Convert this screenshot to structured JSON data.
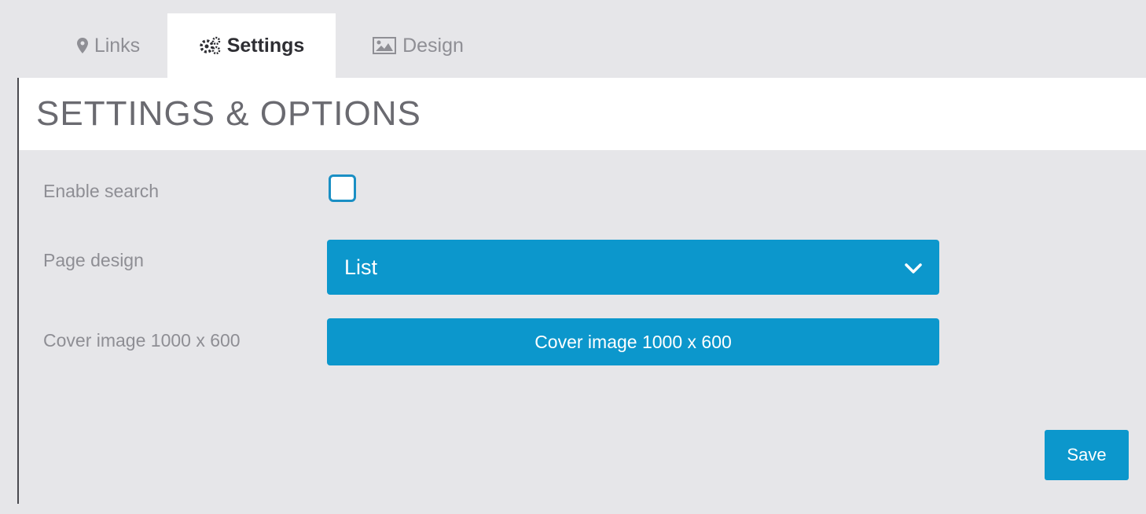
{
  "tabs": [
    {
      "label": "Links",
      "icon": "map-marker-icon",
      "active": false
    },
    {
      "label": "Settings",
      "icon": "cogs-icon",
      "active": true
    },
    {
      "label": "Design",
      "icon": "image-icon",
      "active": false
    }
  ],
  "section": {
    "title": "SETTINGS & OPTIONS"
  },
  "form": {
    "enable_search": {
      "label": "Enable search",
      "checked": false
    },
    "page_design": {
      "label": "Page design",
      "value": "List",
      "icon": "chevron-down-icon"
    },
    "cover_image": {
      "label": "Cover image 1000 x 600",
      "button_label": "Cover image 1000 x 600"
    }
  },
  "actions": {
    "save_label": "Save"
  },
  "colors": {
    "accent": "#0c97cc",
    "background": "#e6e6e9",
    "header": "#ffffff"
  }
}
